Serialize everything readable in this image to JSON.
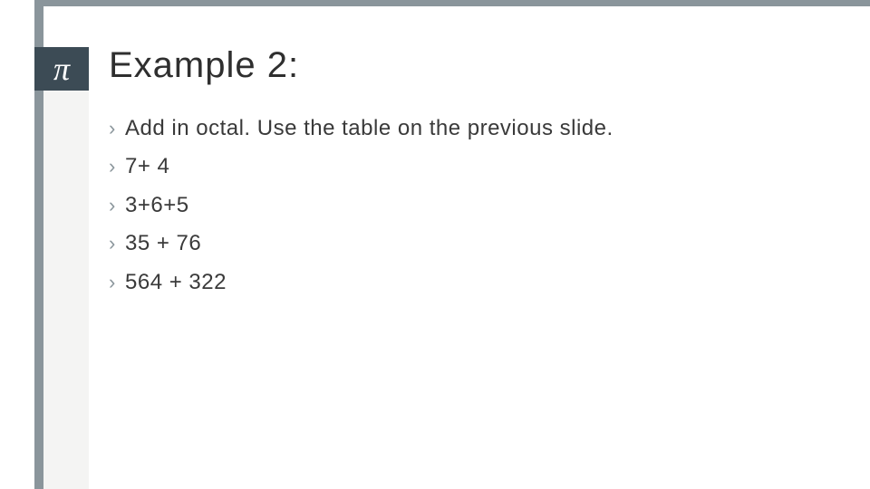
{
  "icon": {
    "pi_glyph": "π"
  },
  "slide": {
    "title": "Example 2:",
    "bullets": [
      "Add in octal. Use the table on the previous slide.",
      "7+ 4",
      "3+6+5",
      "35 + 76",
      "564 + 322"
    ]
  }
}
